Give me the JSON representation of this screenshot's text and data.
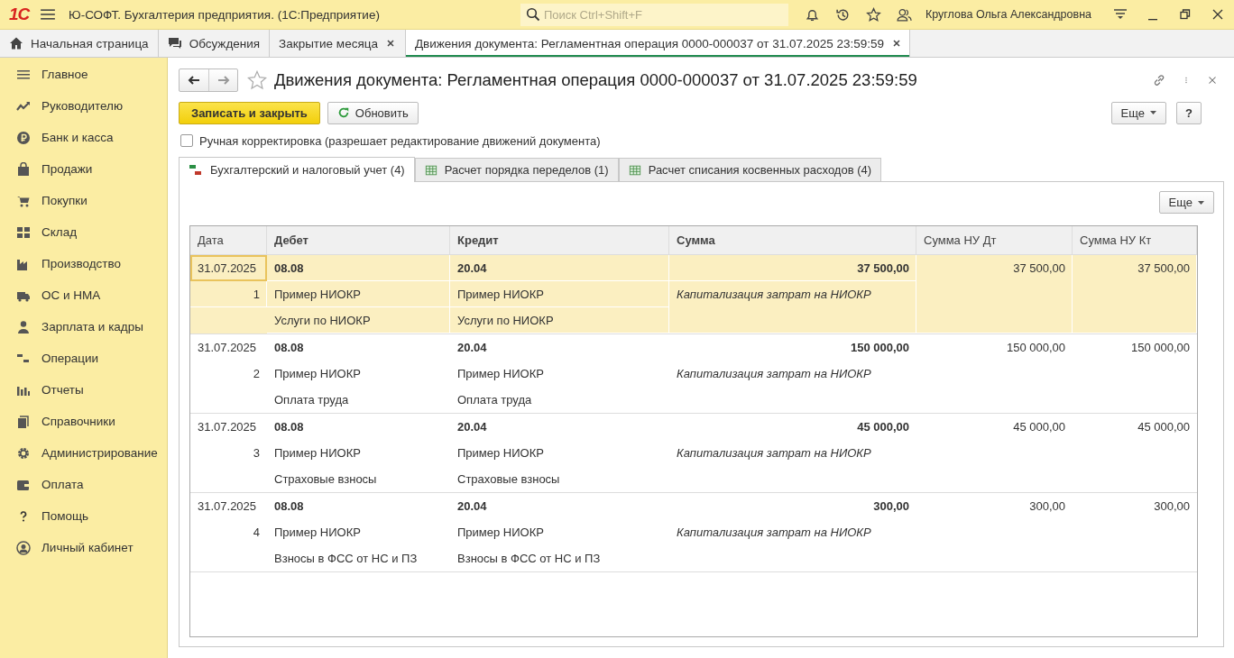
{
  "app_bar": {
    "logo": "1С",
    "title": "Ю-СОФТ. Бухгалтерия предприятия.  (1С:Предприятие)",
    "search": {
      "placeholder": "Поиск Ctrl+Shift+F"
    },
    "user": "Круглова Ольга Александровна"
  },
  "open_tabs": [
    {
      "label": "Начальная страница",
      "kind": "home",
      "selected": false
    },
    {
      "label": "Обсуждения",
      "kind": "chat",
      "selected": false
    },
    {
      "label": "Закрытие месяца",
      "kind": "closable",
      "selected": false
    },
    {
      "label": "Движения документа: Регламентная операция 0000-000037 от 31.07.2025 23:59:59",
      "kind": "closable",
      "selected": true
    }
  ],
  "sidebar": {
    "items": [
      "Главное",
      "Руководителю",
      "Банк и касса",
      "Продажи",
      "Покупки",
      "Склад",
      "Производство",
      "ОС и НМА",
      "Зарплата и кадры",
      "Операции",
      "Отчеты",
      "Справочники",
      "Администрирование",
      "Оплата",
      "Помощь",
      "Личный кабинет"
    ]
  },
  "form": {
    "title": "Движения документа: Регламентная операция 0000-000037 от 31.07.2025 23:59:59",
    "buttons": {
      "save": "Записать и закрыть",
      "refresh": "Обновить",
      "more": "Еще",
      "help": "?"
    },
    "manual_edit": {
      "label": "Ручная корректировка (разрешает редактирование движений документа)",
      "checked": false
    },
    "tabs": [
      {
        "label": "Бухгалтерский и налоговый учет (4)",
        "kind": "accounting",
        "selected": true
      },
      {
        "label": "Расчет порядка переделов (1)",
        "kind": "register",
        "selected": false
      },
      {
        "label": "Расчет списания косвенных расходов (4)",
        "kind": "register",
        "selected": false
      }
    ],
    "table_more": "Еще",
    "table": {
      "columns": [
        "Дата",
        "Дебет",
        "Кредит",
        "Сумма",
        "Сумма НУ Дт",
        "Сумма НУ Кт"
      ],
      "rows": [
        {
          "selected": true,
          "date": "31.07.2025",
          "number": "1",
          "debit": {
            "account": "08.08",
            "subconto": [
              "Пример НИОКР",
              "Услуги по НИОКР"
            ]
          },
          "credit": {
            "account": "20.04",
            "subconto": [
              "Пример НИОКР",
              "Услуги по НИОКР"
            ]
          },
          "amount": "37 500,00",
          "content": "Капитализация затрат на НИОКР",
          "amount_nu_dt": "37 500,00",
          "amount_nu_kt": "37 500,00"
        },
        {
          "selected": false,
          "date": "31.07.2025",
          "number": "2",
          "debit": {
            "account": "08.08",
            "subconto": [
              "Пример НИОКР",
              "Оплата труда"
            ]
          },
          "credit": {
            "account": "20.04",
            "subconto": [
              "Пример НИОКР",
              "Оплата труда"
            ]
          },
          "amount": "150 000,00",
          "content": "Капитализация затрат на НИОКР",
          "amount_nu_dt": "150 000,00",
          "amount_nu_kt": "150 000,00"
        },
        {
          "selected": false,
          "date": "31.07.2025",
          "number": "3",
          "debit": {
            "account": "08.08",
            "subconto": [
              "Пример НИОКР",
              "Страховые взносы"
            ]
          },
          "credit": {
            "account": "20.04",
            "subconto": [
              "Пример НИОКР",
              "Страховые взносы"
            ]
          },
          "amount": "45 000,00",
          "content": "Капитализация затрат на НИОКР",
          "amount_nu_dt": "45 000,00",
          "amount_nu_kt": "45 000,00"
        },
        {
          "selected": false,
          "date": "31.07.2025",
          "number": "4",
          "debit": {
            "account": "08.08",
            "subconto": [
              "Пример НИОКР",
              "Взносы в ФСС от НС и ПЗ"
            ]
          },
          "credit": {
            "account": "20.04",
            "subconto": [
              "Пример НИОКР",
              "Взносы в ФСС от НС и ПЗ"
            ]
          },
          "amount": "300,00",
          "content": "Капитализация затрат на НИОКР",
          "amount_nu_dt": "300,00",
          "amount_nu_kt": "300,00"
        }
      ]
    }
  }
}
